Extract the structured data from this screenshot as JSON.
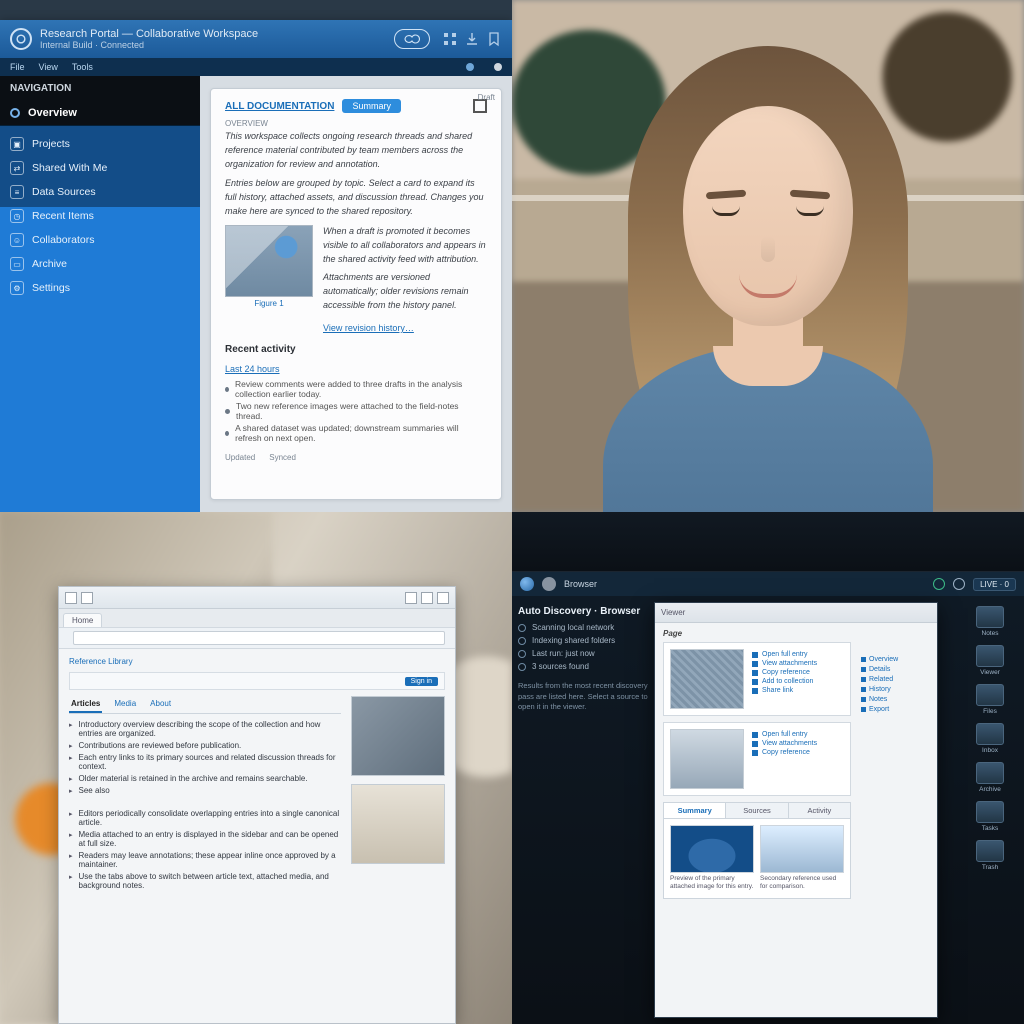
{
  "qA": {
    "titlebar": {
      "title_line1": "Research Portal — Collaborative Workspace",
      "title_line2": "Internal Build · Connected"
    },
    "menubar": {
      "item1": "File",
      "item2": "View",
      "item3": "Tools"
    },
    "sidebar": {
      "header": "NAVIGATION",
      "selected": "Overview",
      "items": [
        {
          "label": "Projects"
        },
        {
          "label": "Shared With Me"
        },
        {
          "label": "Data Sources"
        },
        {
          "label": "Recent Items"
        },
        {
          "label": "Collaborators"
        },
        {
          "label": "Archive"
        },
        {
          "label": "Settings"
        }
      ]
    },
    "doc": {
      "pill": "ALL DOCUMENTATION",
      "tab": "Summary",
      "sidecol": "Draft",
      "mini": "OVERVIEW",
      "p1": "This workspace collects ongoing research threads and shared reference material contributed by team members across the organization for review and annotation.",
      "p2": "Entries below are grouped by topic. Select a card to expand its full history, attached assets, and discussion thread. Changes you make here are synced to the shared repository.",
      "thumb_caption": "Figure 1",
      "side_p1": "When a draft is promoted it becomes visible to all collaborators and appears in the shared activity feed with attribution.",
      "side_p2": "Attachments are versioned automatically; older revisions remain accessible from the history panel.",
      "link1": "View revision history…",
      "h4": "Recent activity",
      "sub_link": "Last 24 hours",
      "l1": "Review comments were added to three drafts in the analysis collection earlier today.",
      "l2": "Two new reference images were attached to the field-notes thread.",
      "l3": "A shared dataset was updated; downstream summaries will refresh on next open.",
      "foot_a": "Updated",
      "foot_b": "Synced"
    }
  },
  "qC": {
    "tabs": {
      "t1": "Home"
    },
    "crumb": "Reference Library",
    "chip": "Sign in",
    "tablike": {
      "a": "Articles",
      "b": "Media",
      "c": "About"
    },
    "b1": "Introductory overview describing the scope of the collection and how entries are organized.",
    "b2": "Contributions are reviewed before publication.",
    "b3": "Each entry links to its primary sources and related discussion threads for context.",
    "b4": "Older material is retained in the archive and remains searchable.",
    "b5": "See also",
    "c1": "Editors periodically consolidate overlapping entries into a single canonical article.",
    "c2": "Media attached to an entry is displayed in the sidebar and can be opened at full size.",
    "c3": "Readers may leave annotations; these appear inline once approved by a maintainer.",
    "c4": "Use the tabs above to switch between article text, attached media, and background notes."
  },
  "qD": {
    "taskbar": {
      "label": "Browser",
      "pill": "LIVE · 0",
      "gear_label": "⚙"
    },
    "panel": {
      "title": "Auto Discovery · Browser",
      "r1": "Scanning local network",
      "r2": "Indexing shared folders",
      "r3": "Last run: just now",
      "r4": "3 sources found",
      "cap": "Results from the most recent discovery pass are listed here. Select a source to open it in the viewer."
    },
    "browser": {
      "tab": "Viewer",
      "h6": "Page",
      "sideLinks": [
        "Overview",
        "Details",
        "Related",
        "History",
        "Notes",
        "Export"
      ],
      "cardLinks": [
        "Open full entry",
        "View attachments",
        "Copy reference",
        "Add to collection",
        "Share link"
      ],
      "tabs2": {
        "a": "Summary",
        "b": "Sources",
        "c": "Activity"
      },
      "tileCap1": "Preview of the primary attached image for this entry.",
      "tileCap2": "Secondary reference used for comparison."
    },
    "desktop_icons": [
      "Notes",
      "Viewer",
      "Files",
      "Inbox",
      "Archive",
      "Tasks",
      "Trash"
    ]
  }
}
